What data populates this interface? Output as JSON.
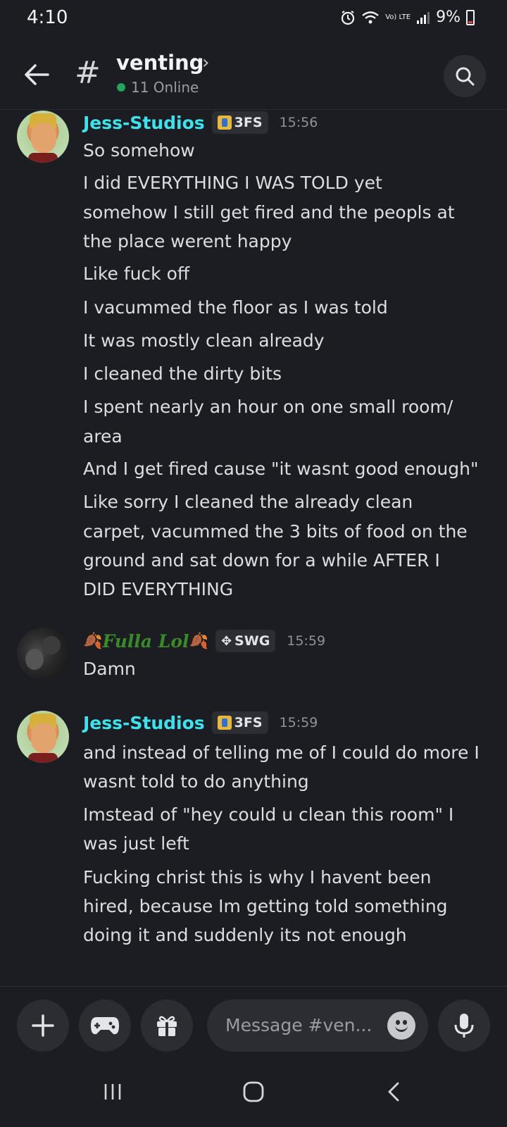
{
  "status_bar": {
    "time": "4:10",
    "network": "Vo) LTE",
    "battery_percent": "9%"
  },
  "header": {
    "channel_name": "venting",
    "online_count": "11 Online"
  },
  "messages": [
    {
      "author": "Jess-Studios",
      "tag": "3FS",
      "time": "15:56",
      "lines": [
        "So somehow",
        "I did EVERYTHING I WAS TOLD yet",
        "somehow I still get fired and the peopls at",
        "the place werent happy",
        "Like fuck off",
        "I vacummed the floor as I was told",
        "It was mostly clean already",
        "I cleaned the dirty bits",
        "I spent nearly an hour on one small room/",
        "area",
        "And I get fired cause \"it wasnt good enough\"",
        "Like sorry I cleaned the already clean",
        "carpet, vacummed the 3 bits of food on the",
        "ground and sat down for a while AFTER I",
        "DID EVERYTHING"
      ]
    },
    {
      "author": "Fulla Lol",
      "tag": "SWG",
      "time": "15:59",
      "lines": [
        "Damn"
      ]
    },
    {
      "author": "Jess-Studios",
      "tag": "3FS",
      "time": "15:59",
      "lines": [
        "and instead of telling me of I could do more I",
        "wasnt told to do anything",
        "Imstead of \"hey could u clean this room\" I",
        "was just left",
        "Fucking christ this is why I havent been",
        "hired, because Im getting told something",
        "doing it and suddenly its not enough"
      ]
    }
  ],
  "composer": {
    "placeholder": "Message #ven..."
  },
  "icons": {
    "back": "back-arrow-icon",
    "search": "search-icon",
    "add": "plus-icon",
    "games": "gamepad-icon",
    "gift": "gift-icon",
    "emoji": "emoji-icon",
    "voice": "microphone-icon"
  },
  "colors": {
    "background": "#1c1d22",
    "author_cyan": "#3fe1ec",
    "online_green": "#23a55a"
  }
}
